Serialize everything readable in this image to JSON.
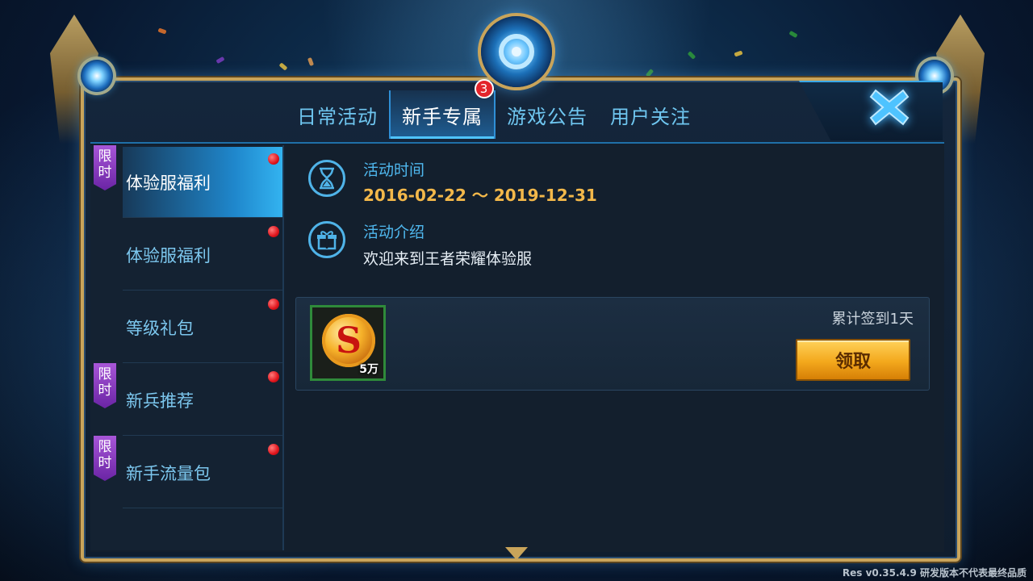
{
  "tabs": [
    {
      "label": "日常活动",
      "active": false
    },
    {
      "label": "新手专属",
      "active": true,
      "badge": "3"
    },
    {
      "label": "游戏公告",
      "active": false
    },
    {
      "label": "用户关注",
      "active": false
    }
  ],
  "sidebar": {
    "items": [
      {
        "label": "体验服福利",
        "active": true,
        "limited": true,
        "limit_tag": "限时"
      },
      {
        "label": "体验服福利",
        "active": false,
        "limited": false
      },
      {
        "label": "等级礼包",
        "active": false,
        "limited": false
      },
      {
        "label": "新兵推荐",
        "active": false,
        "limited": true,
        "limit_tag": "限时"
      },
      {
        "label": "新手流量包",
        "active": false,
        "limited": true,
        "limit_tag": "限时"
      }
    ]
  },
  "activity": {
    "time_label": "活动时间",
    "time_range": "2016-02-22 ～ 2019-12-31",
    "intro_label": "活动介绍",
    "intro_text": "欢迎来到王者荣耀体验服"
  },
  "reward": {
    "item_icon": "gold-coin-icon",
    "item_letter": "S",
    "quantity": "5万",
    "sign_in_text": "累计签到1天",
    "claim_label": "领取"
  },
  "footer": {
    "version": "Res v0.35.4.9 研发版本不代表最终品质"
  },
  "colors": {
    "frame_gold": "#c9a45a",
    "accent_blue": "#4fb8ef",
    "date_orange": "#f3b84a",
    "badge_red": "#e3242b",
    "limit_purple": "#8a3cc0",
    "claim_gold": "#f3a81c"
  }
}
